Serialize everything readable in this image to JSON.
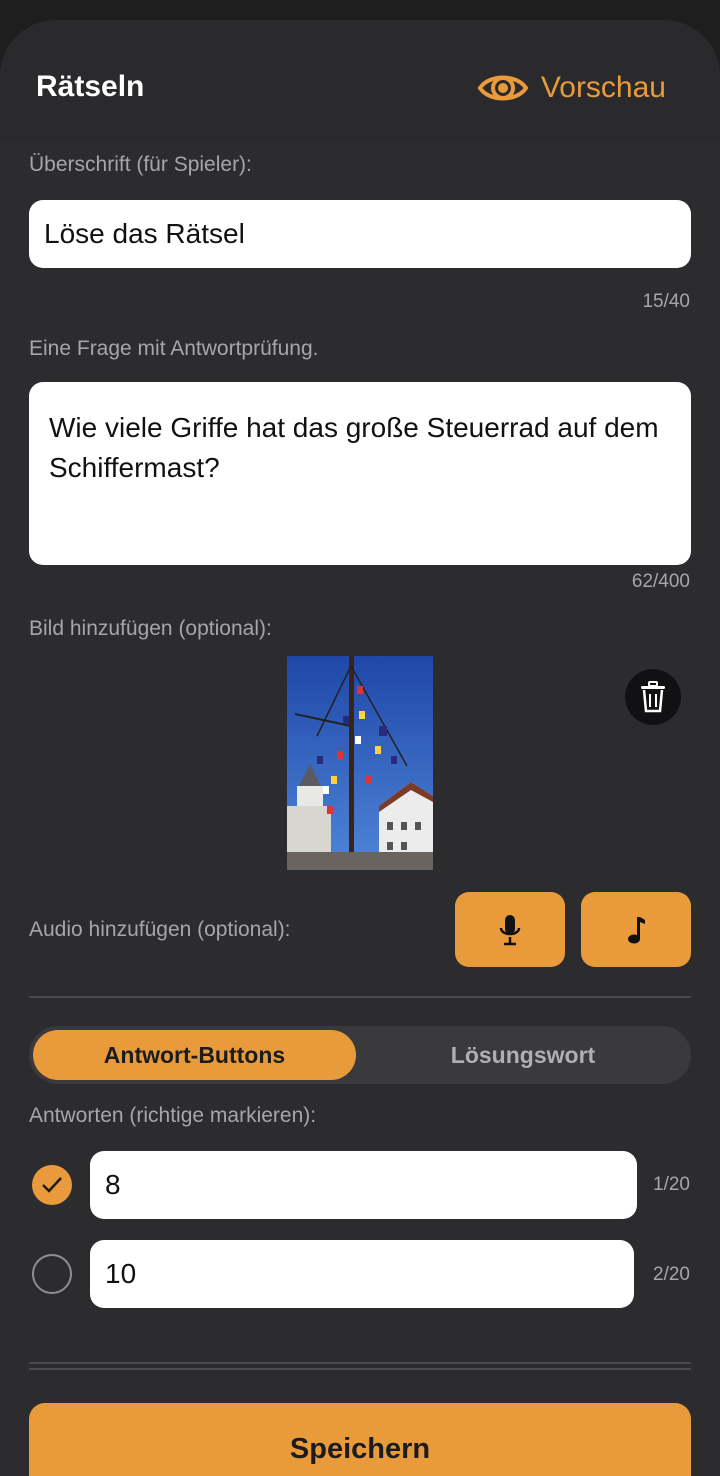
{
  "header": {
    "title": "Rätseln",
    "preview_label": "Vorschau",
    "preview_icon": "eye-icon"
  },
  "heading": {
    "label": "Überschrift (für Spieler):",
    "value": "Löse das Rätsel",
    "counter": "15/40"
  },
  "question": {
    "label": "Eine Frage mit Antwortprüfung.",
    "value": "Wie viele Griffe hat das große Steuerrad auf dem Schiffermast?",
    "counter": "62/400"
  },
  "image": {
    "label": "Bild hinzufügen (optional):",
    "delete_icon": "trash-icon"
  },
  "audio": {
    "label": "Audio hinzufügen (optional):",
    "record_icon": "microphone-icon",
    "file_icon": "music-note-icon"
  },
  "mode": {
    "options": [
      "Antwort-Buttons",
      "Lösungswort"
    ],
    "selected": "Antwort-Buttons"
  },
  "answers": {
    "label": "Antworten (richtige markieren):",
    "items": [
      {
        "value": "8",
        "counter": "1/20",
        "correct": true
      },
      {
        "value": "10",
        "counter": "2/20",
        "correct": false
      }
    ]
  },
  "save_label": "Speichern",
  "colors": {
    "accent": "#e99b3c",
    "background": "#2c2c2e"
  }
}
